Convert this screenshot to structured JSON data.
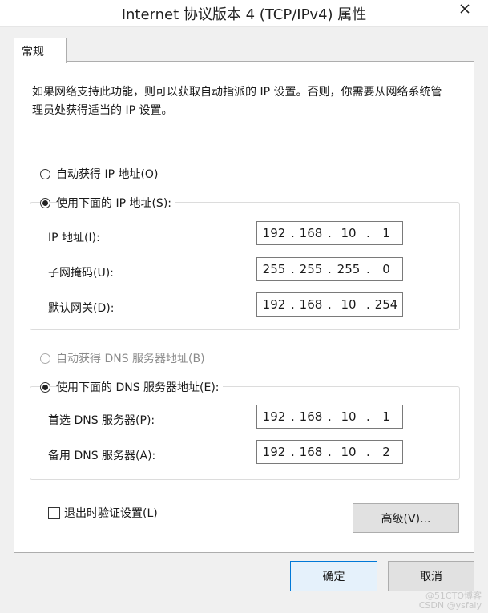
{
  "window": {
    "title": "Internet 协议版本 4 (TCP/IPv4) 属性",
    "close_glyph": "✕"
  },
  "tabs": [
    {
      "label": "常规",
      "selected": true
    }
  ],
  "description": "如果网络支持此功能，则可以获取自动指派的 IP 设置。否则，你需要从网络系统管理员处获得适当的 IP 设置。",
  "ip_section": {
    "auto_label": "自动获得 IP 地址(O)",
    "manual_label": "使用下面的 IP 地址(S):",
    "selected": "manual",
    "fields": [
      {
        "label": "IP 地址(I):",
        "octets": [
          "192",
          "168",
          "10",
          "1"
        ]
      },
      {
        "label": "子网掩码(U):",
        "octets": [
          "255",
          "255",
          "255",
          "0"
        ]
      },
      {
        "label": "默认网关(D):",
        "octets": [
          "192",
          "168",
          "10",
          "254"
        ]
      }
    ]
  },
  "dns_section": {
    "auto_label": "自动获得 DNS 服务器地址(B)",
    "auto_disabled": true,
    "manual_label": "使用下面的 DNS 服务器地址(E):",
    "selected": "manual",
    "fields": [
      {
        "label": "首选 DNS 服务器(P):",
        "octets": [
          "192",
          "168",
          "10",
          "1"
        ]
      },
      {
        "label": "备用 DNS 服务器(A):",
        "octets": [
          "192",
          "168",
          "10",
          "2"
        ]
      }
    ]
  },
  "validate_on_exit": {
    "label": "退出时验证设置(L)",
    "checked": false
  },
  "buttons": {
    "advanced": "高级(V)...",
    "ok": "确定",
    "cancel": "取消"
  },
  "watermark": "@51CTO博客\nCSDN @ysfaly"
}
